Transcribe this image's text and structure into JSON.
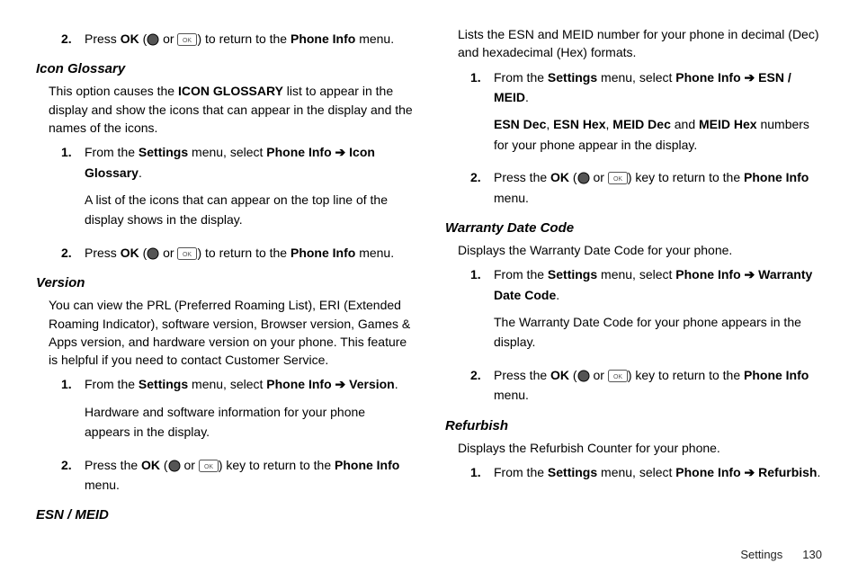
{
  "footer": {
    "section": "Settings",
    "page": "130"
  },
  "step0": {
    "num": "2.",
    "t1": "Press ",
    "t2": "OK",
    "t3": " (",
    "t4": " or ",
    "t5": ") to return to the ",
    "t6": "Phone Info",
    "t7": " menu."
  },
  "iconGlossary": {
    "heading": "Icon Glossary",
    "intro1": "This option causes the ",
    "intro2": "ICON GLOSSARY",
    "intro3": " list to appear in the display and show the icons that can appear in the display and the names of the icons.",
    "s1": {
      "num": "1.",
      "a": "From the ",
      "b": "Settings",
      "c": " menu, select ",
      "d": "Phone Info",
      "arrow": " ➔ ",
      "e": "Icon Glossary",
      "f": ".",
      "extra": "A list of the icons that can appear on the top line of the display shows in the display."
    },
    "s2": {
      "num": "2.",
      "a": "Press ",
      "b": "OK",
      "c": " (",
      "d": " or ",
      "e": ") to return to the ",
      "f": "Phone Info",
      "g": " menu."
    }
  },
  "version": {
    "heading": "Version",
    "intro": "You can view the PRL (Preferred Roaming List), ERI (Extended Roaming Indicator), software version, Browser version, Games & Apps version, and hardware version on your phone. This feature is helpful if you need to contact Customer Service.",
    "s1": {
      "num": "1.",
      "a": "From the ",
      "b": "Settings",
      "c": " menu, select ",
      "d": "Phone Info",
      "arrow": " ➔ ",
      "e": "Version",
      "f": ".",
      "extra": "Hardware and software information for your phone appears in the display."
    },
    "s2": {
      "num": "2.",
      "a": "Press the ",
      "b": "OK",
      "c": " (",
      "d": " or ",
      "e": ") key to return to the ",
      "f": "Phone Info",
      "g": " menu."
    }
  },
  "esn": {
    "heading": "ESN / MEID",
    "intro": "Lists the ESN and MEID number for your phone in decimal (Dec) and hexadecimal (Hex) formats.",
    "s1": {
      "num": "1.",
      "a": "From the ",
      "b": "Settings",
      "c": " menu, select ",
      "d": "Phone Info",
      "arrow": " ➔ ",
      "e": "ESN / MEID",
      "f": ".",
      "extra1a": "ESN Dec",
      "extra1b": ", ",
      "extra1c": "ESN Hex",
      "extra1d": ", ",
      "extra1e": "MEID Dec",
      "extra1f": " and ",
      "extra1g": "MEID Hex",
      "extra1h": " numbers for your phone appear in the display."
    },
    "s2": {
      "num": "2.",
      "a": "Press the ",
      "b": "OK",
      "c": " (",
      "d": " or ",
      "e": ") key to return to the ",
      "f": "Phone Info",
      "g": " menu."
    }
  },
  "warranty": {
    "heading": "Warranty Date Code",
    "intro": "Displays the Warranty Date Code for your phone.",
    "s1": {
      "num": "1.",
      "a": "From the ",
      "b": "Settings",
      "c": " menu, select ",
      "d": "Phone Info",
      "arrow": " ➔ ",
      "e": "Warranty Date Code",
      "f": ".",
      "extra": "The Warranty Date Code for your phone appears in the display."
    },
    "s2": {
      "num": "2.",
      "a": "Press the ",
      "b": "OK",
      "c": " (",
      "d": " or ",
      "e": ") key to return to the ",
      "f": "Phone Info",
      "g": " menu."
    }
  },
  "refurbish": {
    "heading": "Refurbish",
    "intro": "Displays the Refurbish Counter for your phone.",
    "s1": {
      "num": "1.",
      "a": "From the ",
      "b": "Settings",
      "c": " menu, select ",
      "d": "Phone Info",
      "arrow": " ➔ ",
      "e": "Refurbish",
      "f": "."
    }
  }
}
